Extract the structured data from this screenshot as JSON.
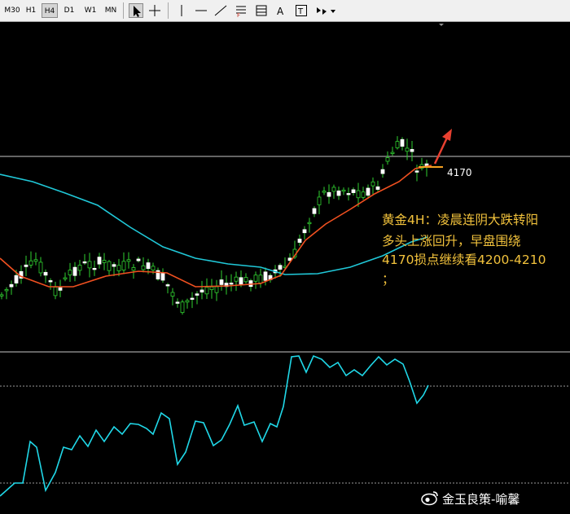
{
  "toolbar": {
    "timeframes": [
      "M30",
      "H1",
      "H4",
      "D1",
      "W1",
      "MN"
    ],
    "active_timeframe": "H4",
    "tools": [
      "cursor-icon",
      "crosshair-icon",
      "vertical-line-icon",
      "horizontal-line-icon",
      "trendline-icon",
      "fibonacci-icon",
      "channel-icon",
      "text-icon",
      "text-label-icon",
      "arrows-icon",
      "dropdown-icon"
    ],
    "text_tool_label": "A",
    "label_tool_label": "T"
  },
  "price_label": "4170",
  "annotation": {
    "line1": "黄金4H：凌晨连阴大跌转阳",
    "line2": "多头上涨回升，早盘围绕",
    "line3": "4170损点继续看4200-4210",
    "line4": "；"
  },
  "watermark": "金玉良策-喻馨",
  "colors": {
    "background": "#000000",
    "bull_candle": "#ffffff",
    "bear_candle": "#30d030",
    "wick": "#30d030",
    "fast_ma": "#f05020",
    "slow_ma": "#20c8d8",
    "indicator": "#20d8e8",
    "annotation_text": "#f2c23c",
    "arrow": "#e84030",
    "price_line": "#c8c8c8"
  }
}
